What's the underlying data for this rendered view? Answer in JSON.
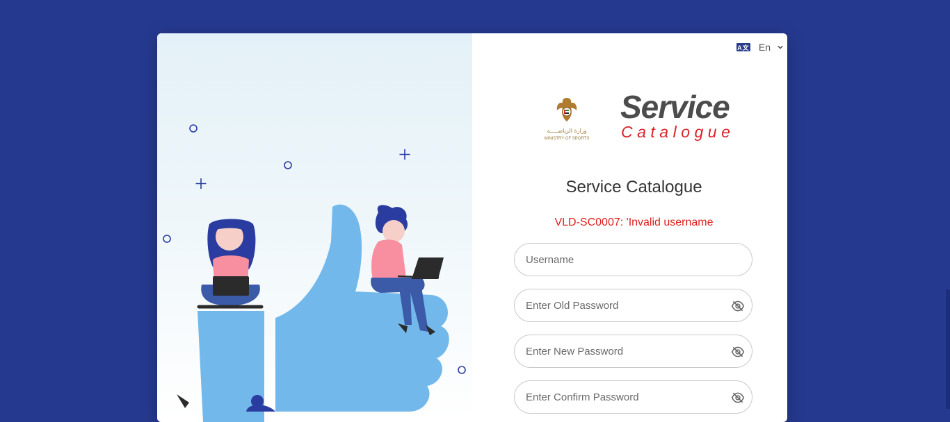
{
  "language": {
    "icon": "translate-icon",
    "current": "En"
  },
  "logos": {
    "emblem_arabic": "وزارة الرياضـــــة",
    "emblem_english": "MINISTRY OF SPORTS",
    "brand_line1": "Service",
    "brand_line2": "Catalogue"
  },
  "form": {
    "title": "Service Catalogue",
    "error": "VLD-SC0007: 'Invalid username",
    "username_placeholder": "Username",
    "old_password_placeholder": "Enter Old Password",
    "new_password_placeholder": "Enter New Password",
    "confirm_password_placeholder": "Enter Confirm Password"
  },
  "colors": {
    "page_bg": "#25398f",
    "brand_grey": "#4c4c4c",
    "brand_red": "#d9242b",
    "error_red": "#e01e1e",
    "illustration_blue": "#72b8ea"
  }
}
